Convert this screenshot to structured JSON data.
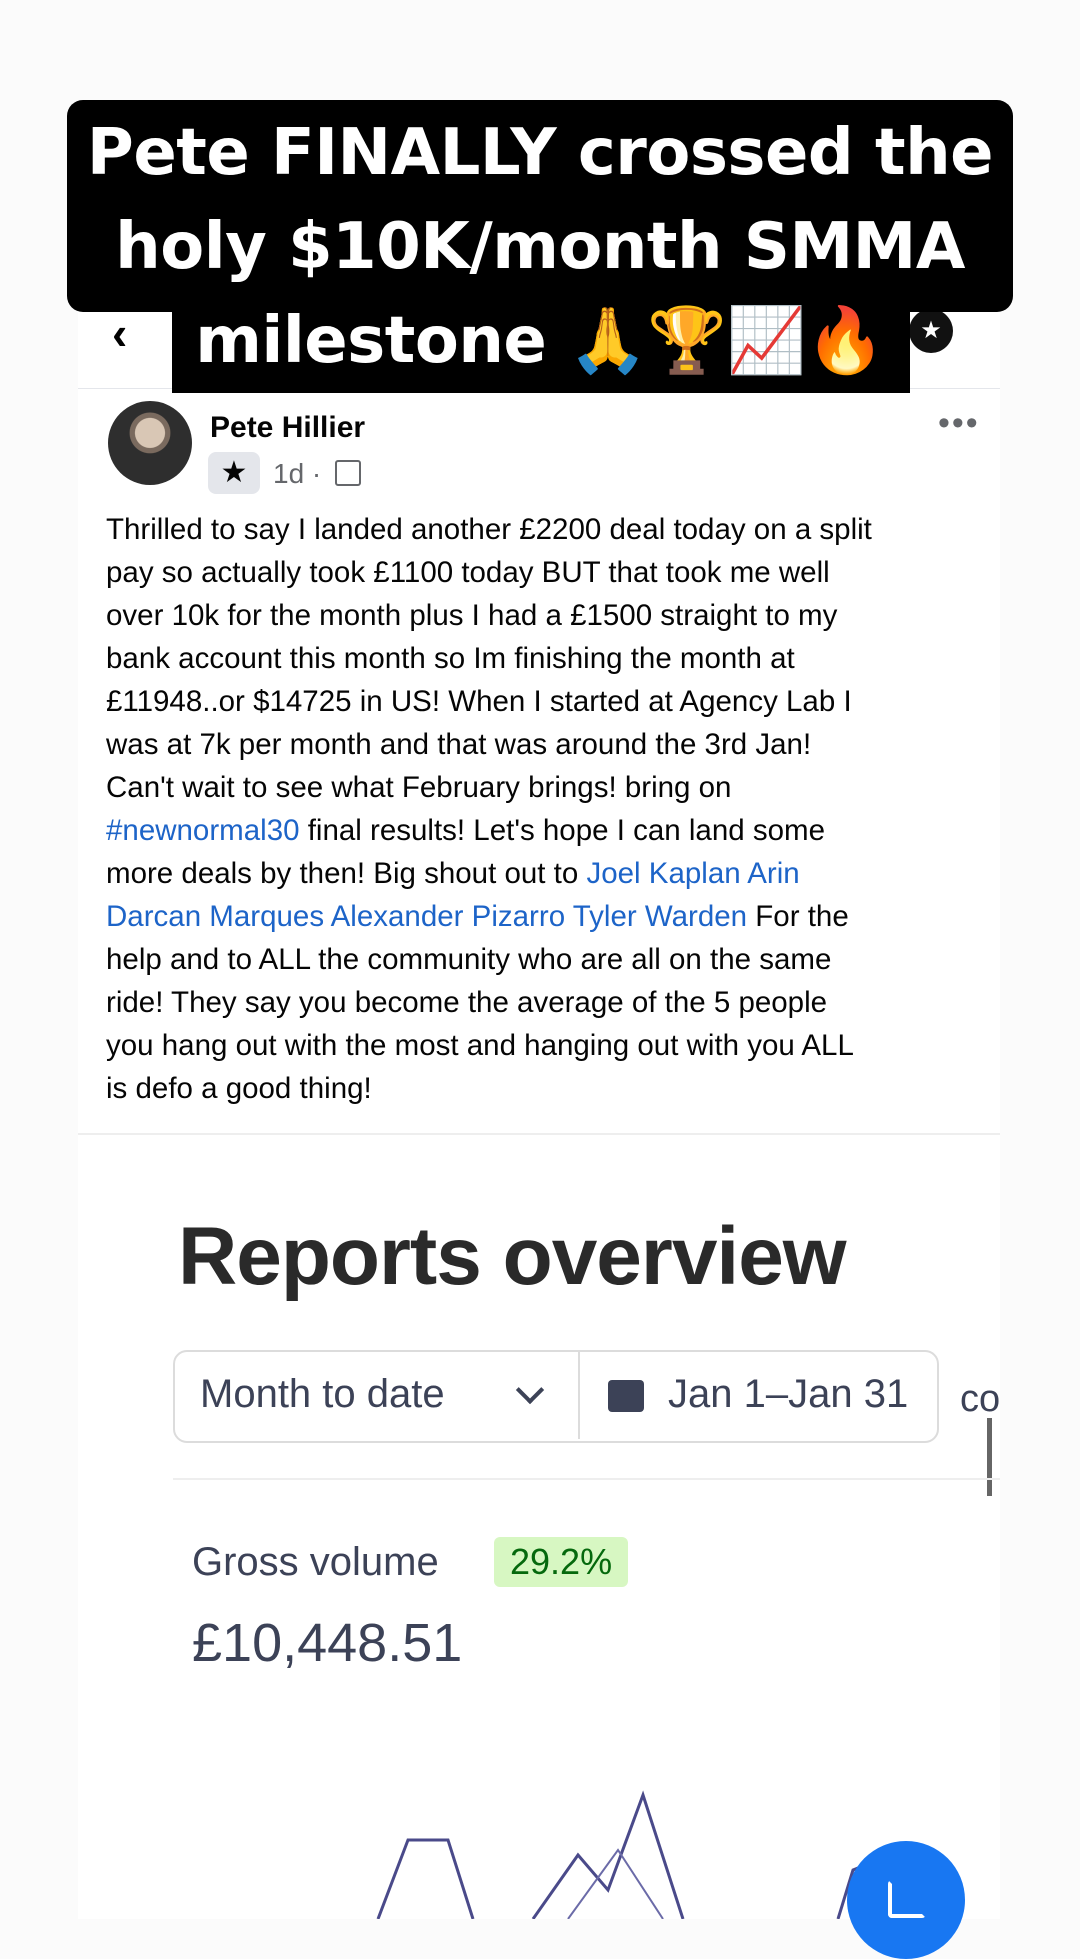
{
  "caption": {
    "line1": "Pete FINALLY crossed the",
    "line2": "holy $10K/month SMMA",
    "line3": "milestone 🙏🏆📈🔥"
  },
  "post": {
    "author": "Pete Hillier",
    "time": "1d ·",
    "lines": {
      "l1": "Thrilled to say I landed another £2200 deal today on a split",
      "l2": "pay so actually took £1100 today BUT that took me well",
      "l3": "over 10k for the month plus I had a £1500 straight to my",
      "l4": "bank account this month so Im finishing the month at",
      "l5": "£11948..or $14725 in US! When I started at Agency Lab I",
      "l6": "was at 7k per month and that was around the 3rd Jan!",
      "l7": "Can't wait to see what February brings! bring on",
      "l8_tag": "#newnormal30",
      "l8_rest": " final results! Let's hope I can land some",
      "l9_pre": "more deals by then! Big shout out to ",
      "l9_link": " Joel Kaplan Arin",
      "l10_link": "Darcan Marques Alexander Pizarro Tyler Warden",
      "l10_rest": " For the",
      "l11": "help and to ALL the community who are all on the same",
      "l12": "ride! They say you become the average of the 5 people",
      "l13": "you hang out with the most and hanging out with you ALL",
      "l14": "is defo a good thing!"
    }
  },
  "report": {
    "title": "Reports overview",
    "period": "Month to date",
    "date_range": "Jan 1–Jan 31",
    "compare_cut": "co",
    "gross_label": "Gross volume",
    "gross_change": "29.2%",
    "gross_value": "£10,448.51"
  },
  "icons": [
    "back-arrow-icon",
    "star-icon",
    "more-dots-icon",
    "group-icon",
    "chevron-down-icon",
    "calendar-icon",
    "edit-icon"
  ],
  "colors": {
    "link": "#1d64c8",
    "badge_bg": "#d7f7c2",
    "badge_text": "#05690d",
    "fab": "#1877f2"
  }
}
